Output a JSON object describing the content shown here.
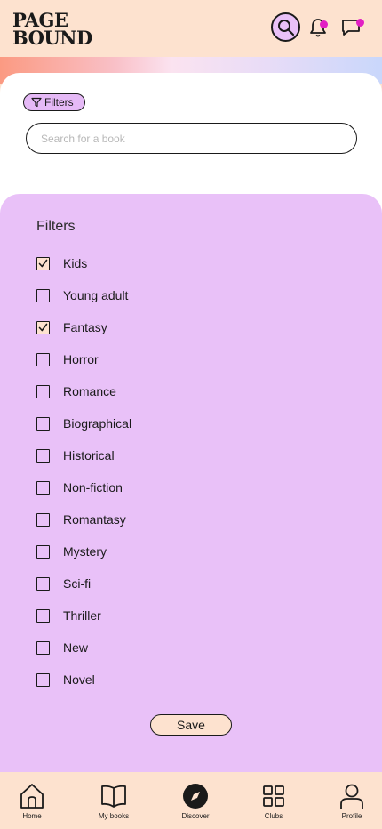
{
  "header": {
    "logo_line1": "PAGE",
    "logo_line2": "BOUND",
    "icons": [
      "search-icon",
      "bell-icon",
      "chat-icon"
    ],
    "notification_dot_color": "#e21fc4"
  },
  "search": {
    "filter_chip_label": "Filters",
    "placeholder": "Search for a book"
  },
  "filters": {
    "title": "Filters",
    "items": [
      {
        "label": "Kids",
        "checked": true
      },
      {
        "label": "Young adult",
        "checked": false
      },
      {
        "label": "Fantasy",
        "checked": true
      },
      {
        "label": "Horror",
        "checked": false
      },
      {
        "label": "Romance",
        "checked": false
      },
      {
        "label": "Biographical",
        "checked": false
      },
      {
        "label": "Historical",
        "checked": false
      },
      {
        "label": "Non-fiction",
        "checked": false
      },
      {
        "label": "Romantasy",
        "checked": false
      },
      {
        "label": "Mystery",
        "checked": false
      },
      {
        "label": "Sci-fi",
        "checked": false
      },
      {
        "label": "Thriller",
        "checked": false
      },
      {
        "label": "New",
        "checked": false
      },
      {
        "label": "Novel",
        "checked": false
      }
    ],
    "save_label": "Save"
  },
  "nav": {
    "items": [
      {
        "label": "Home",
        "icon": "home-icon"
      },
      {
        "label": "My books",
        "icon": "book-icon"
      },
      {
        "label": "Discover",
        "icon": "compass-icon"
      },
      {
        "label": "Clubs",
        "icon": "grid-icon"
      },
      {
        "label": "Profile",
        "icon": "user-icon"
      }
    ]
  },
  "colors": {
    "background": "#fde2cf",
    "panel": "#e9c1f8",
    "accent": "#e21fc4"
  }
}
